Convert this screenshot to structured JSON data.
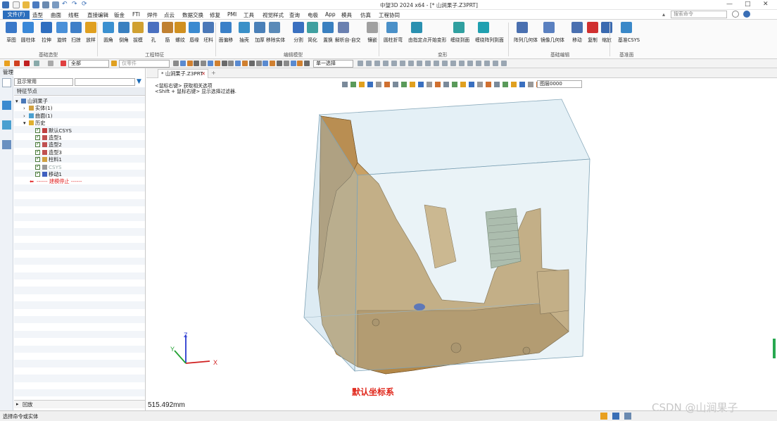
{
  "title_bar": {
    "title": "中望3D 2024 x64 - [* 山涧果子.Z3PRT]"
  },
  "menu": {
    "file": "文件(F)",
    "items": [
      "造型",
      "曲面",
      "线框",
      "直接编辑",
      "钣金",
      "FTI",
      "焊件",
      "点云",
      "数据交换",
      "修复",
      "PMI",
      "工具",
      "视觉样式",
      "查询",
      "电极",
      "App",
      "模具",
      "仿真",
      "工程协同"
    ],
    "search_placeholder": "搜索命令"
  },
  "ribbon": {
    "groups": [
      "基础造型",
      "工程特征",
      "编辑模型",
      "变形",
      "基础编辑",
      "基准面"
    ],
    "buttons": [
      "草图",
      "圆柱体",
      "拉伸",
      "旋转",
      "扫掠",
      "放样",
      "圆角",
      "倒角",
      "拔模",
      "孔",
      "筋",
      "螺纹",
      "唇缘",
      "坯料",
      "面偏移",
      "抽壳",
      "加厚",
      "移除实体",
      "分割",
      "简化",
      "置换",
      "解析自-自交",
      "镶嵌",
      "圆柱折弯",
      "由指定点开始变形",
      "缠绕到面",
      "缠绕阵列到面",
      "阵列几何体",
      "镜像几何体",
      "移动",
      "复制",
      "缩放",
      "基准CSYS"
    ]
  },
  "toolbar2": {
    "filter_value": "全部",
    "part_value": "仅零件",
    "select_value": "单一选择",
    "layer_value": "图层0000"
  },
  "panel": {
    "title": "管理器",
    "display_mode": "显示常用",
    "root_header": "特征节点",
    "tree": [
      {
        "label": "山涧果子",
        "level": 0,
        "expand": "▾",
        "color": "#4a78b8"
      },
      {
        "label": "实体(1)",
        "level": 1,
        "expand": "›",
        "color": "#d0a040"
      },
      {
        "label": "曲面(1)",
        "level": 1,
        "expand": "›",
        "color": "#4aa0d0"
      },
      {
        "label": "历史",
        "level": 1,
        "expand": "▾",
        "color": "#e0b030"
      },
      {
        "label": "默认CSYS",
        "level": 2,
        "expand": "",
        "color": "#c04040",
        "check": true
      },
      {
        "label": "造型1",
        "level": 2,
        "expand": "",
        "color": "#c05050",
        "check": true
      },
      {
        "label": "造型2",
        "level": 2,
        "expand": "",
        "color": "#c05050",
        "check": true
      },
      {
        "label": "造型3",
        "level": 2,
        "expand": "",
        "color": "#c05050",
        "check": true
      },
      {
        "label": "柱料1",
        "level": 2,
        "expand": "",
        "color": "#d0a040",
        "check": true
      },
      {
        "label": "CSYS",
        "level": 2,
        "expand": "",
        "color": "#999999",
        "check": true,
        "dim": true
      },
      {
        "label": "移动1",
        "level": 2,
        "expand": "",
        "color": "#4060c0",
        "check": true
      },
      {
        "label": "------ 建模停止 ------",
        "level": 2,
        "expand": "",
        "color": "#e02020",
        "stop": true
      }
    ],
    "footer": "回放"
  },
  "viewport": {
    "tab_label": "* 山涧果子.Z3PRT",
    "hint1": "<鼠标右键> 获取相关选项",
    "hint2": "<Shift + 鼠标右键> 显示选择过滤器.",
    "axis_label": "默认坐标系",
    "measure": "515.492mm",
    "axes": {
      "x": "X",
      "y": "Y",
      "z": "Z"
    }
  },
  "status": {
    "text": "选择命令或实体",
    "watermark": "CSDN @山涧果子"
  },
  "colors": {
    "accent": "#2c6fbd",
    "model": "#c7a066",
    "box": "#9ec6dc",
    "red_label": "#e0261a"
  }
}
